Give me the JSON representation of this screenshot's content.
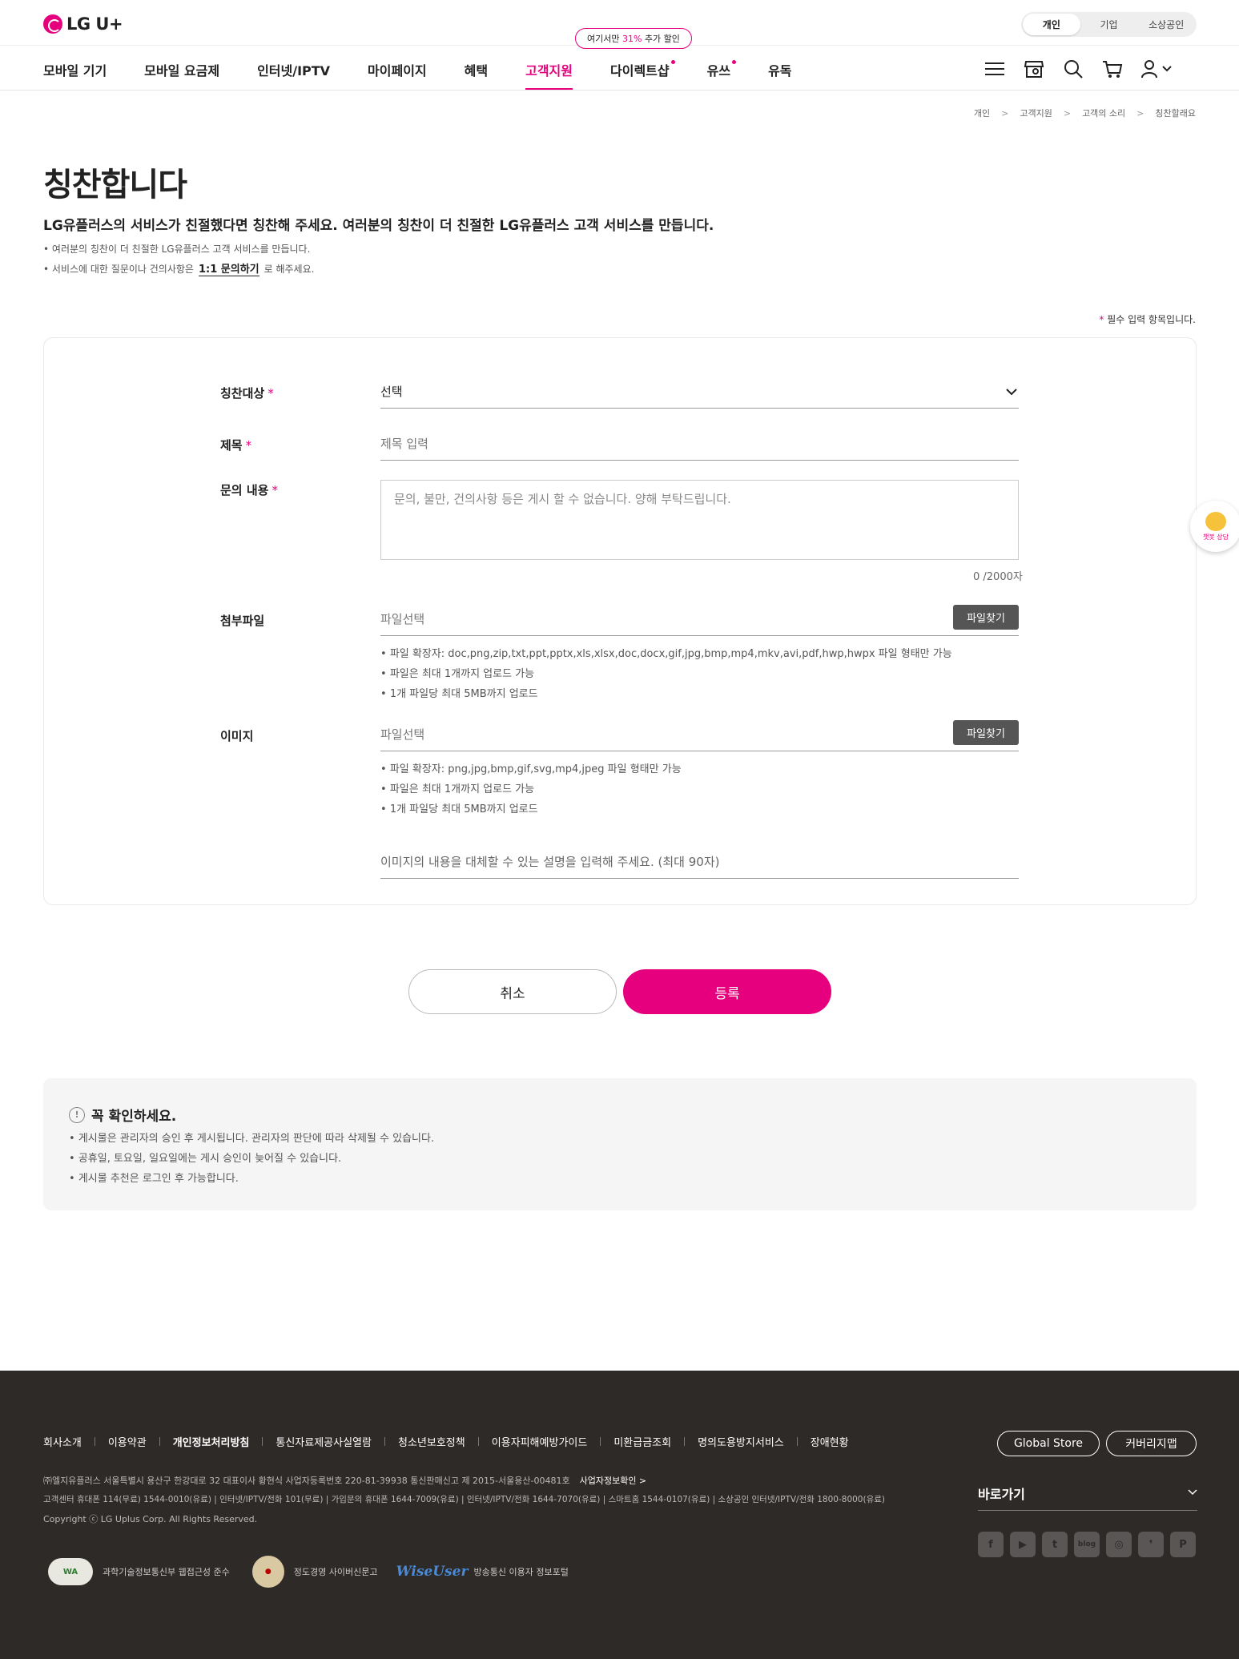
{
  "header": {
    "logo": "LG U+",
    "segments": [
      "개인",
      "기업",
      "소상공인"
    ],
    "nav": [
      "모바일 기기",
      "모바일 요금제",
      "인터넷/IPTV",
      "마이페이지",
      "혜택",
      "고객지원",
      "다이렉트샵",
      "유쓰",
      "유독"
    ],
    "promo_prefix": "여기서만",
    "promo_value": "31%",
    "promo_suffix": "추가 할인",
    "icons": [
      "menu-icon",
      "store-icon",
      "search-icon",
      "cart-icon",
      "user-icon"
    ]
  },
  "breadcrumb": [
    "개인",
    "고객지원",
    "고객의 소리",
    "칭찬할래요"
  ],
  "page": {
    "title": "칭찬합니다",
    "lead": "LG유플러스의 서비스가 친절했다면 칭찬해 주세요. 여러분의 칭찬이 더 친절한 LG유플러스 고객 서비스를 만듭니다.",
    "note1": "여러분의 칭찬이 더 친절한 LG유플러스 고객 서비스를 만듭니다.",
    "note2_prefix": "서비스에 대한 질문이나 건의사항은",
    "note2_link": "1:1 문의하기",
    "note2_suffix": "로 해주세요.",
    "required_mark": "*",
    "required_text": "필수 입력 항목입니다."
  },
  "form": {
    "target_label": "칭찬대상",
    "target_value": "선택",
    "title_label": "제목",
    "title_placeholder": "제목 입력",
    "content_label": "문의 내용",
    "content_placeholder": "문의, 불만, 건의사항 등은 게시 할 수 없습니다. 양해 부탁드립니다.",
    "counter": "0 /2000자",
    "attach_label": "첨부파일",
    "attach_placeholder": "파일선택",
    "attach_button": "파일찾기",
    "attach_notes": [
      "파일 확장자: doc,png,zip,txt,ppt,pptx,xls,xlsx,doc,docx,gif,jpg,bmp,mp4,mkv,avi,pdf,hwp,hwpx 파일 형태만 가능",
      "파일은 최대 1개까지 업로드 가능",
      "1개 파일당 최대 5MB까지 업로드"
    ],
    "image_label": "이미지",
    "image_placeholder": "파일선택",
    "image_button": "파일찾기",
    "image_notes": [
      "파일 확장자: png,jpg,bmp,gif,svg,mp4,jpeg 파일 형태만 가능",
      "파일은 최대 1개까지 업로드 가능",
      "1개 파일당 최대 5MB까지 업로드"
    ],
    "alt_placeholder": "이미지의 내용을 대체할 수 있는 설명을 입력해 주세요. (최대 90자)",
    "cancel": "취소",
    "submit": "등록"
  },
  "notice": {
    "title": "꼭 확인하세요.",
    "items": [
      "게시물은 관리자의 승인 후 게시됩니다. 관리자의 판단에 따라 삭제될 수 있습니다.",
      "공휴일, 토요일, 일요일에는 게시 승인이 늦어질 수 있습니다.",
      "게시물 추천은 로그인 후 가능합니다."
    ]
  },
  "chatbot": "챗봇 상담",
  "footer": {
    "links": [
      "회사소개",
      "이용약관",
      "개인정보처리방침",
      "통신자료제공사실열람",
      "청소년보호정책",
      "이용자피해예방가이드",
      "미환급금조회",
      "명의도용방지서비스",
      "장애현황"
    ],
    "global_store": "Global Store",
    "coverage_map": "커버리지맵",
    "company_info": "㈜엘지유플러스 서울특별시 용산구 한강대로 32 대표이사 황현식 사업자등록번호 220-81-39938 통신판매신고 제 2015-서울용산-00481호",
    "company_link": "사업자정보확인 >",
    "cs_info": "고객센터 휴대폰 114(무료) 1544-0010(유료) | 인터넷/IPTV/전화 101(무료) | 가입문의 휴대폰 1644-7009(유료) | 인터넷/IPTV/전화 1644-7070(유료) | 스마트홈 1544-0107(유료) | 소상공인 인터넷/IPTV/전화 1800-8000(유료)",
    "copyright": "Copyright ⓒ LG Uplus Corp. All Rights Reserved.",
    "shortcut": "바로가기",
    "sns": [
      "f",
      "▶",
      "t",
      "blog",
      "◎",
      "❜",
      "P"
    ],
    "certs": [
      "과학기술정보통신부 웹접근성 준수",
      "정도경영 사이버신문고",
      "방송통신 이용자 정보포털"
    ],
    "cert_logo1": "WA",
    "cert_logo3": "WiseUser"
  }
}
